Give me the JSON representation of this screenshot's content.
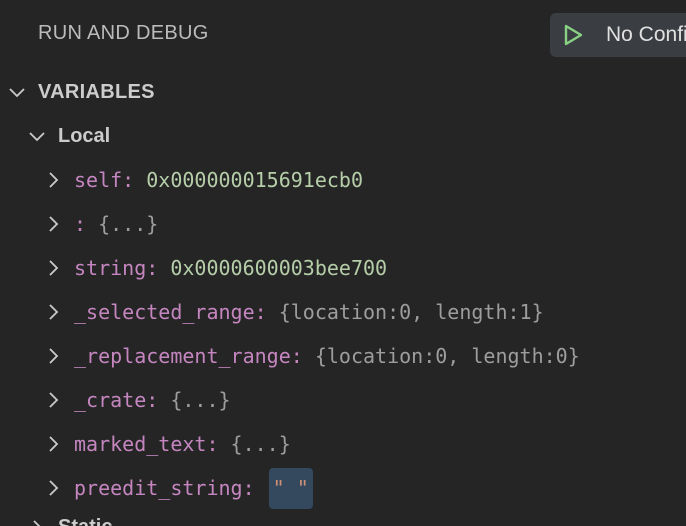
{
  "header": {
    "title": "RUN AND DEBUG",
    "run_config_label": "No Configurations"
  },
  "variables_section": {
    "title": "VARIABLES",
    "scopes": [
      {
        "label": "Local",
        "expanded": true,
        "variables": [
          {
            "name": "self",
            "value": "0x000000015691ecb0",
            "kind": "number"
          },
          {
            "name": "",
            "value": "{...}",
            "kind": "object"
          },
          {
            "name": "string",
            "value": "0x0000600003bee700",
            "kind": "number"
          },
          {
            "name": "_selected_range",
            "value": "{location:0, length:1}",
            "kind": "object"
          },
          {
            "name": "_replacement_range",
            "value": "{location:0, length:0}",
            "kind": "object"
          },
          {
            "name": "_crate",
            "value": "{...}",
            "kind": "object"
          },
          {
            "name": "marked_text",
            "value": "{...}",
            "kind": "object"
          },
          {
            "name": "preedit_string",
            "value": "\" \"",
            "kind": "string"
          }
        ]
      },
      {
        "label": "Static",
        "expanded": false
      }
    ]
  },
  "icons": {
    "play": "play-icon",
    "expanded": "chevron-down-icon",
    "collapsed": "chevron-right-icon"
  },
  "colors": {
    "background": "#252526",
    "play_green": "#89d185",
    "var_name": "#c586c0",
    "number_value": "#b5cea8",
    "object_value": "#9d9d9d",
    "string_value": "#ce9178",
    "string_highlight": "#34495e"
  }
}
